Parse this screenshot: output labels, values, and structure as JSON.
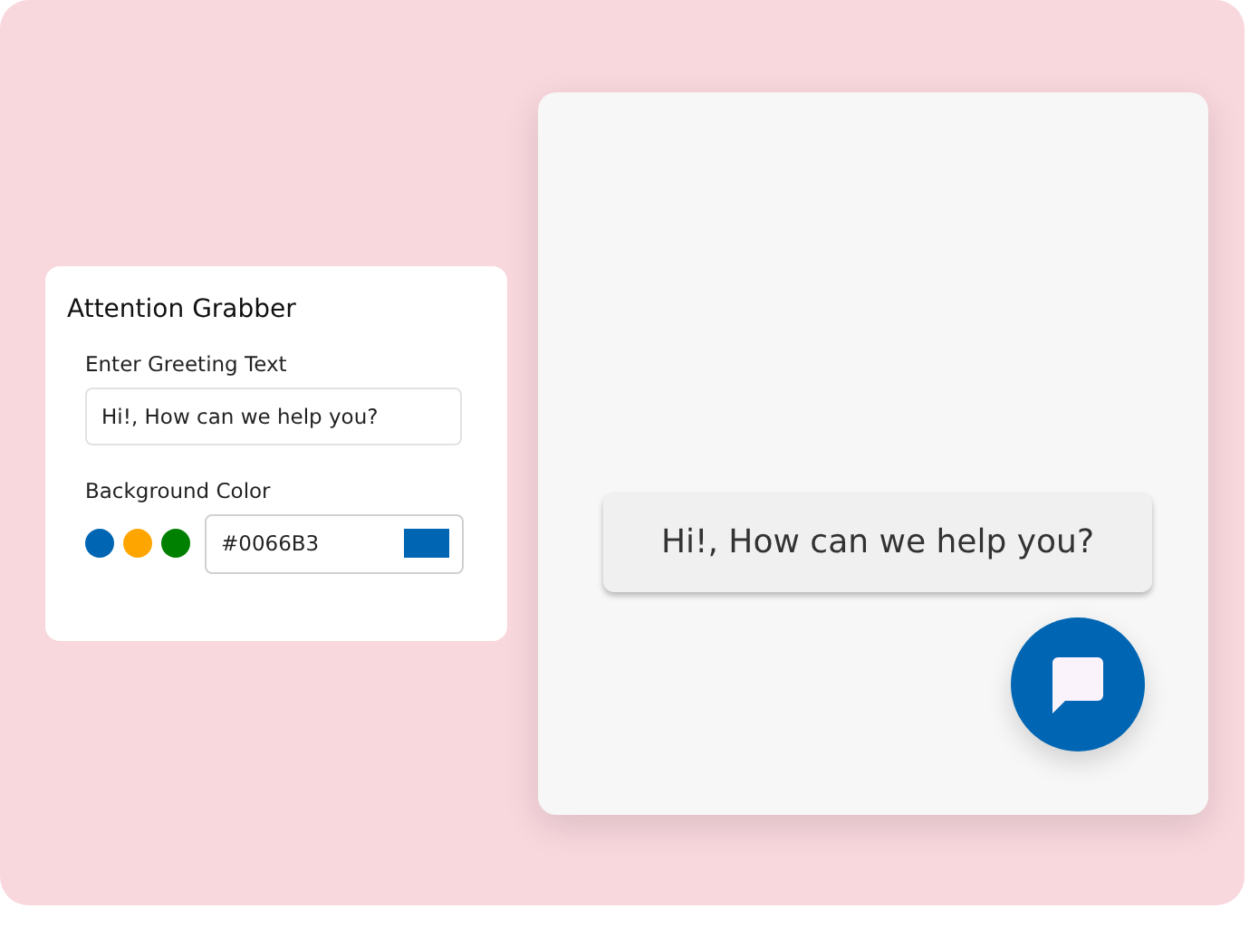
{
  "settings": {
    "title": "Attention Grabber",
    "greeting": {
      "label": "Enter Greeting Text",
      "value": "Hi!, How can we help you?"
    },
    "background": {
      "label": "Background Color",
      "swatches": [
        {
          "color": "#0066b3"
        },
        {
          "color": "#ffa500"
        },
        {
          "color": "#008000"
        }
      ],
      "value": "#0066B3",
      "color": "#0066b3"
    }
  },
  "preview": {
    "bubble": "Hi!, How can we help you?"
  }
}
